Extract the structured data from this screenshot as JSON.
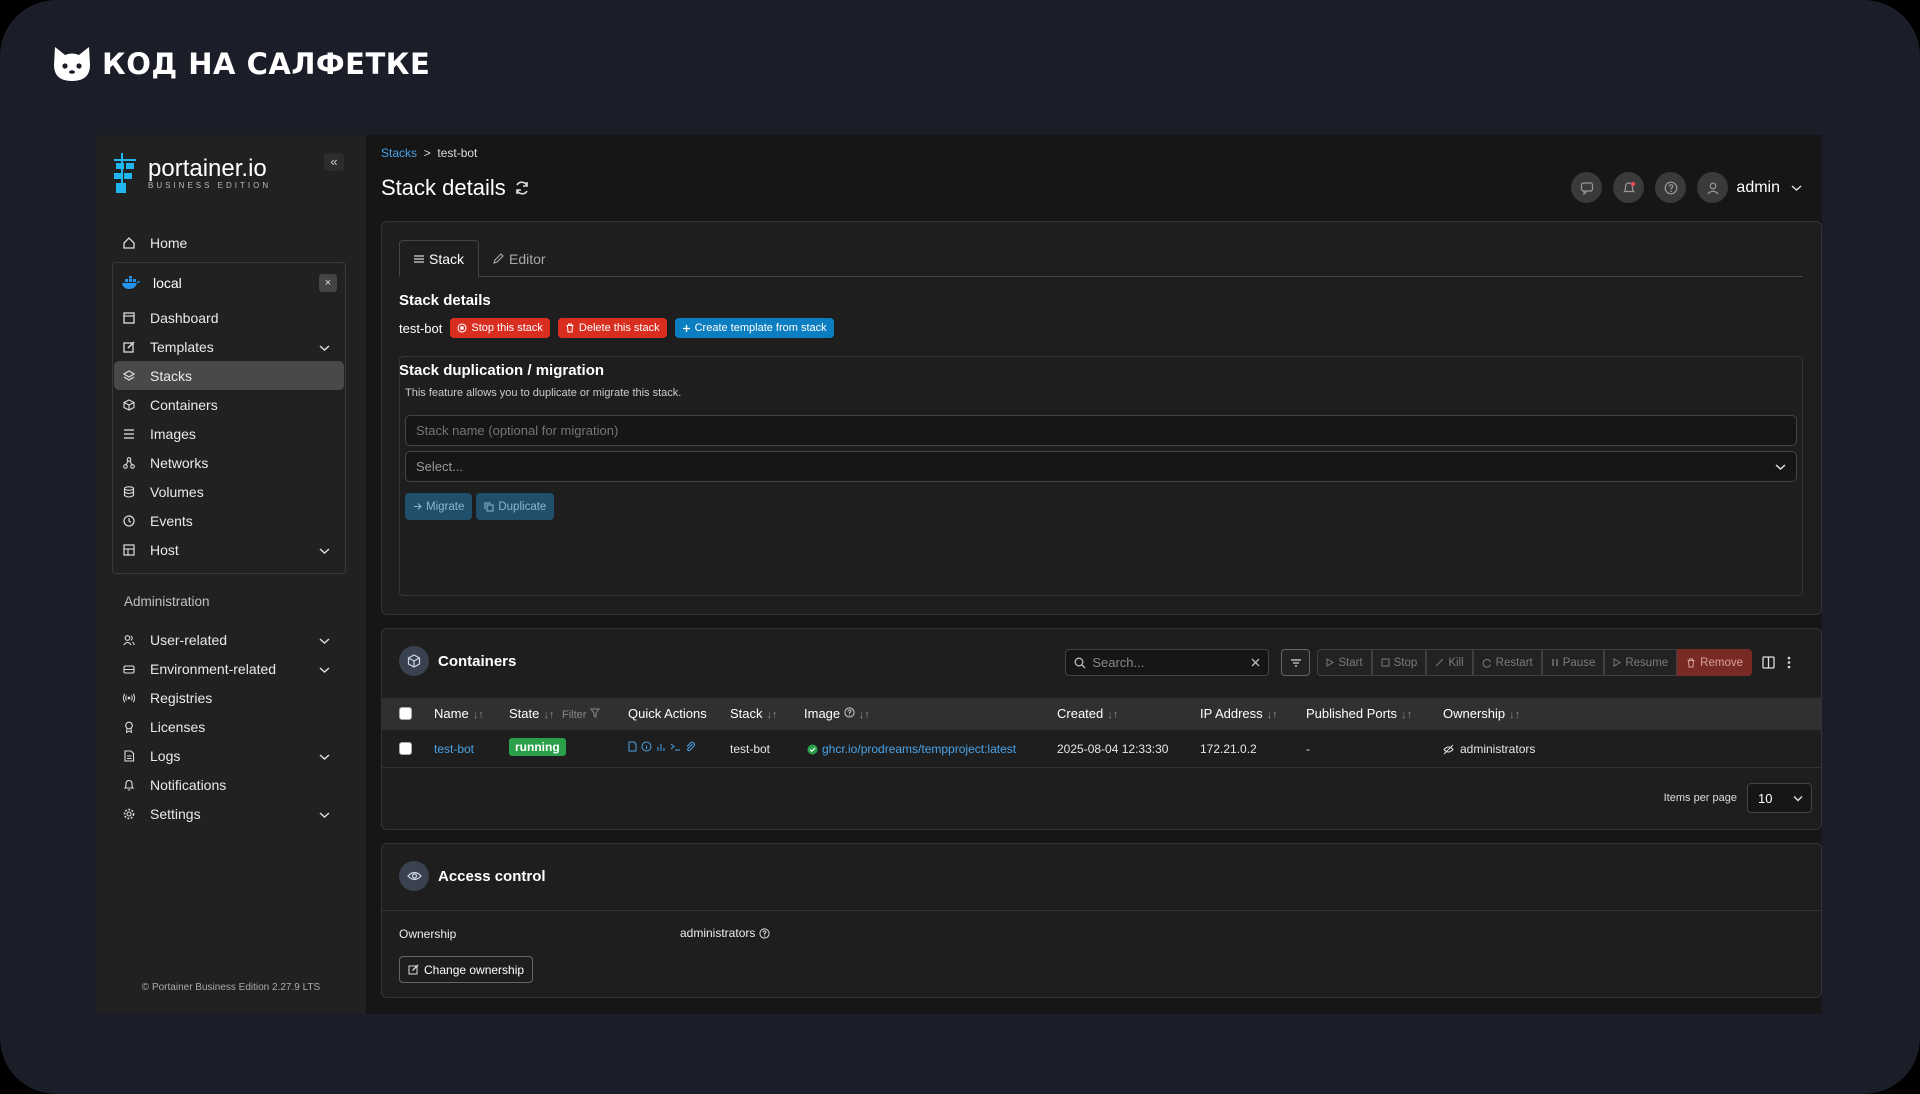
{
  "brand": {
    "text": "КОД НА САЛФЕТКЕ"
  },
  "sidebar": {
    "logo_name": "portainer.io",
    "logo_sub": "BUSINESS EDITION",
    "collapse": "«",
    "home": "Home",
    "environment": {
      "name": "local",
      "close": "×"
    },
    "env_items": [
      {
        "label": "Dashboard",
        "icon": "dashboard-icon"
      },
      {
        "label": "Templates",
        "icon": "edit-icon"
      },
      {
        "label": "Stacks",
        "icon": "layers-icon"
      },
      {
        "label": "Containers",
        "icon": "box-icon"
      },
      {
        "label": "Images",
        "icon": "list-icon"
      },
      {
        "label": "Networks",
        "icon": "network-icon"
      },
      {
        "label": "Volumes",
        "icon": "database-icon"
      },
      {
        "label": "Events",
        "icon": "clock-icon"
      },
      {
        "label": "Host",
        "icon": "grid-icon"
      }
    ],
    "administration_label": "Administration",
    "admin_items": [
      {
        "label": "User-related"
      },
      {
        "label": "Environment-related"
      },
      {
        "label": "Registries"
      },
      {
        "label": "Licenses"
      },
      {
        "label": "Logs"
      },
      {
        "label": "Notifications"
      },
      {
        "label": "Settings"
      }
    ],
    "footer": "© Portainer Business Edition 2.27.9 LTS"
  },
  "header": {
    "breadcrumb_link": "Stacks",
    "breadcrumb_sep": ">",
    "breadcrumb_current": "test-bot",
    "title": "Stack details",
    "user": "admin"
  },
  "stack_panel": {
    "tab_stack": "Stack",
    "tab_editor": "Editor",
    "section_title": "Stack details",
    "stack_name": "test-bot",
    "btn_stop": "Stop this stack",
    "btn_delete": "Delete this stack",
    "btn_template": "Create template from stack",
    "dup_title": "Stack duplication / migration",
    "dup_desc": "This feature allows you to duplicate or migrate this stack.",
    "name_placeholder": "Stack name (optional for migration)",
    "select_placeholder": "Select...",
    "btn_migrate": "Migrate",
    "btn_duplicate": "Duplicate"
  },
  "containers": {
    "title": "Containers",
    "search_placeholder": "Search...",
    "actions": [
      "Start",
      "Stop",
      "Kill",
      "Restart",
      "Pause",
      "Resume",
      "Remove"
    ],
    "columns": {
      "name": "Name",
      "state": "State",
      "filter": "Filter",
      "quick_actions": "Quick Actions",
      "stack": "Stack",
      "image": "Image",
      "created": "Created",
      "ip": "IP Address",
      "ports": "Published Ports",
      "ownership": "Ownership"
    },
    "rows": [
      {
        "name": "test-bot",
        "state": "running",
        "stack": "test-bot",
        "image": "ghcr.io/prodreams/tempproject:latest",
        "created": "2025-08-04 12:33:30",
        "ip": "172.21.0.2",
        "ports": "-",
        "ownership": "administrators"
      }
    ],
    "items_per_page_label": "Items per page",
    "items_per_page": "10"
  },
  "access": {
    "title": "Access control",
    "ownership_label": "Ownership",
    "ownership_value": "administrators",
    "change_btn": "Change ownership"
  },
  "colors": {
    "accent": "#4aa3e8",
    "danger": "#d92d20",
    "success": "#2aa04a",
    "primary": "#0b7ec1"
  }
}
